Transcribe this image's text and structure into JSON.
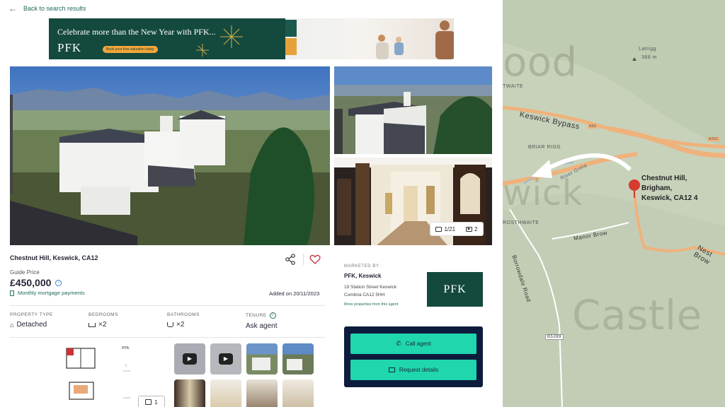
{
  "back_link": {
    "icon": "arrow-left-icon",
    "label": "Back to search results"
  },
  "banner": {
    "tagline": "Celebrate more than the New Year with PFK...",
    "brand": "PFK",
    "cta": "Book your free valuation today"
  },
  "gallery": {
    "photo_count": "1/21",
    "video_count": "2"
  },
  "listing": {
    "address": "Chestnut Hill, Keswick, CA12",
    "guide_label": "Guide Price",
    "price": "£450,000",
    "mortgage_link": "Monthly mortgage payments",
    "added": "Added on 20/11/2023",
    "property_type_label": "PROPERTY TYPE",
    "property_type": "Detached",
    "bedrooms_label": "BEDROOMS",
    "bedrooms": "×2",
    "bathrooms_label": "BATHROOMS",
    "bathrooms": "×2",
    "tenure_label": "TENURE",
    "tenure": "Ask agent"
  },
  "thumbnails": {
    "pfk_small": "PFK",
    "image_count": "1"
  },
  "agent": {
    "marketed_by": "MARKETED BY",
    "name": "PFK, Keswick",
    "address_line1": "19 Station Street Keswick",
    "address_line2": "Cumbria CA12 5HH",
    "more_link": "More properties from this agent",
    "logo": "PFK",
    "call_label": "Call agent",
    "request_label": "Request details"
  },
  "map": {
    "labels": {
      "latrigg": "Latrigg",
      "latrigg_height": "368 m",
      "twaite": "TWAITE",
      "keswick_bypass": "Keswick Bypass",
      "a66": "A66",
      "a591": "A591",
      "briar_rigg": "BRIAR RIGG",
      "river_greta": "River Greta",
      "rosthwaite": "ROSTHWAITE",
      "manor_brow": "Manor Brow",
      "nest_brow": "Nest Brow",
      "borrowdale_road": "Borrowdale Road",
      "b5289": "B5289",
      "watermark_wood": "ood",
      "watermark_wick": "wick",
      "watermark_castle": "Castle"
    },
    "pin_label_line1": "Chestnut Hill,",
    "pin_label_line2": "Brigham,",
    "pin_label_line3": "Keswick, CA12 4"
  },
  "colors": {
    "brand_green": "#14493e",
    "accent_teal": "#1fd6ad",
    "navy": "#0d1b3c",
    "link_green": "#1f6b5c",
    "map_road": "#f0b27a",
    "pin_red": "#d63b2f"
  }
}
